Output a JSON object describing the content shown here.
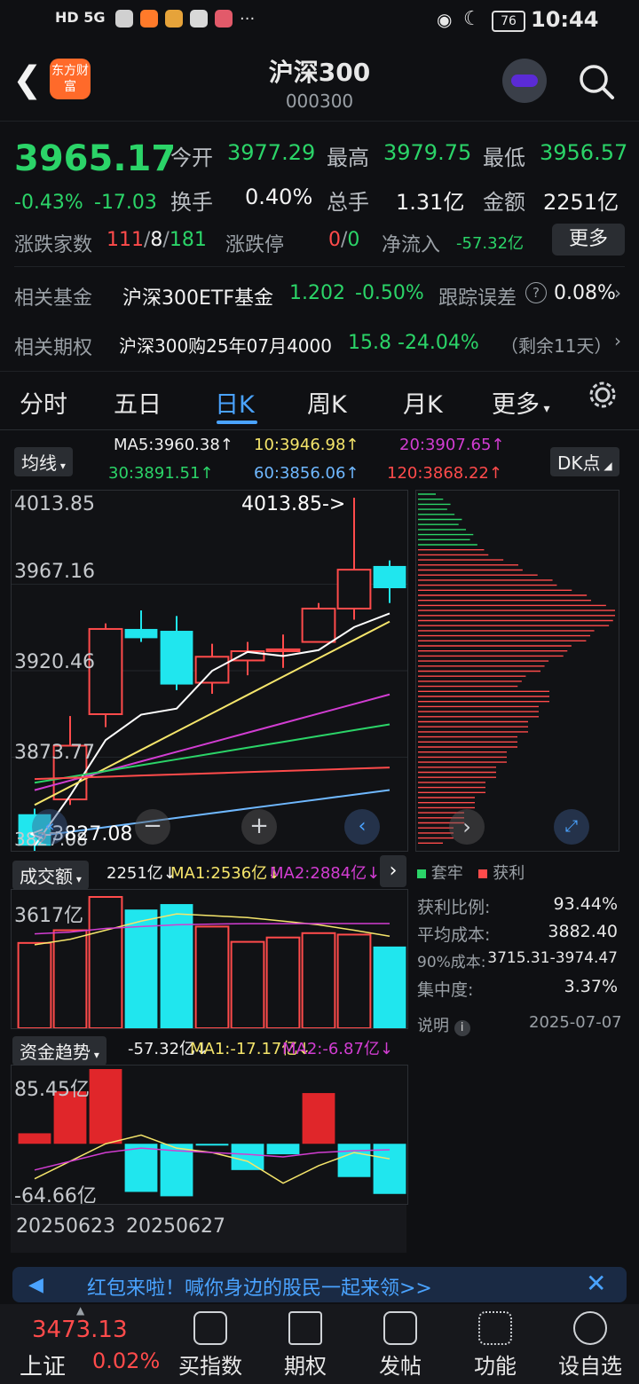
{
  "status_bar": {
    "left_text": "HD 5G",
    "time": "10:44",
    "battery": "76"
  },
  "header": {
    "logo_text": "东方财富",
    "title": "沪深300",
    "code": "000300"
  },
  "quote": {
    "price": "3965.17",
    "change_pct": "-0.43%",
    "change": "-17.03",
    "open_label": "今开",
    "open": "3977.29",
    "high_label": "最高",
    "high": "3979.75",
    "low_label": "最低",
    "low": "3956.57",
    "turnover_label": "换手",
    "turnover": "0.40%",
    "volume_label": "总手",
    "volume": "1.31亿",
    "amount_label": "金额",
    "amount": "2251亿",
    "adv_label": "涨跌家数",
    "adv_up": "111",
    "adv_sep1": "/",
    "adv_flat": "8",
    "adv_sep2": "/",
    "adv_down": "181",
    "limit_label": "涨跌停",
    "limit_up": "0",
    "limit_sep": "/",
    "limit_down": "0",
    "inflow_label": "净流入",
    "inflow": "-57.32亿",
    "more_button": "更多"
  },
  "related": {
    "fund_label": "相关基金",
    "fund_name": "沪深300ETF基金",
    "fund_price": "1.202",
    "fund_chg": "-0.50%",
    "tracking_label": "跟踪误差",
    "tracking_value": "0.08%",
    "option_label": "相关期权",
    "option_name": "沪深300购25年07月4000",
    "option_price": "15.8",
    "option_chg": "-24.04%",
    "option_days": "（剩余11天）"
  },
  "tabs": [
    "分时",
    "五日",
    "日K",
    "周K",
    "月K",
    "更多"
  ],
  "ma_bar": {
    "selector": "均线",
    "ma5": "MA5:3960.38↑",
    "ma10": "10:3946.98↑",
    "ma20": "20:3907.65↑",
    "ma30": "30:3891.51↑",
    "ma60": "60:3856.06↑",
    "ma120": "120:3868.22↑",
    "dk_button": "DK点"
  },
  "kline": {
    "y_labels": [
      "4013.85",
      "3967.16",
      "3920.46",
      "3873.77",
      "3827.08"
    ],
    "high_marker": "4013.85->",
    "low_marker": "<-3827.08"
  },
  "chip_legend": {
    "trapped": "套牢",
    "profit": "获利"
  },
  "chip_stats": [
    {
      "label": "获利比例:",
      "value": "93.44%"
    },
    {
      "label": "平均成本:",
      "value": "3882.40"
    },
    {
      "label": "90%成本:",
      "value": "3715.31-3974.47"
    },
    {
      "label": "集中度:",
      "value": "3.37%"
    }
  ],
  "chip_note": {
    "label": "说明",
    "date": "2025-07-07"
  },
  "volume_bar": {
    "selector": "成交额",
    "value": "2251亿↓",
    "ma1": "MA1:2536亿↓",
    "ma2": "MA2:2884亿↓",
    "y_top": "3617亿"
  },
  "fund_bar": {
    "selector": "资金趋势",
    "value": "-57.32亿↓",
    "ma1": "MA1:-17.17亿↓",
    "ma2": "MA2:-6.87亿↓",
    "y_top": "85.45亿",
    "y_bottom": "-64.66亿"
  },
  "dates": [
    "20250623",
    "20250627"
  ],
  "banner": {
    "text": "红包来啦！喊你身边的股民一起来领>>"
  },
  "bottom_nav": {
    "index_name": "上证",
    "index_value": "3473.13",
    "index_chg": "0.02%",
    "items": [
      "买指数",
      "期权",
      "发帖",
      "功能",
      "设自选"
    ]
  },
  "colors": {
    "up": "#ff4b4b",
    "down": "#2bd468",
    "accent": "#4aa3ff",
    "cyan": "#20e6ee"
  },
  "chart_data": {
    "type": "candlestick",
    "candles": [
      {
        "open": 3843,
        "close": 3826,
        "high": 3846,
        "low": 3820
      },
      {
        "open": 3851,
        "close": 3880,
        "high": 3896,
        "low": 3848
      },
      {
        "open": 3897,
        "close": 3943,
        "high": 3946,
        "low": 3890
      },
      {
        "open": 3943,
        "close": 3938,
        "high": 3953,
        "low": 3936
      },
      {
        "open": 3942,
        "close": 3913,
        "high": 3950,
        "low": 3910
      },
      {
        "open": 3914,
        "close": 3928,
        "high": 3935,
        "low": 3908
      },
      {
        "open": 3926,
        "close": 3931,
        "high": 3936,
        "low": 3918
      },
      {
        "open": 3931,
        "close": 3932,
        "high": 3940,
        "low": 3922
      },
      {
        "open": 3936,
        "close": 3954,
        "high": 3957,
        "low": 3936
      },
      {
        "open": 3954,
        "close": 3975,
        "high": 4013.85,
        "low": 3948
      },
      {
        "open": 3977,
        "close": 3965,
        "high": 3980,
        "low": 3957
      }
    ],
    "ylim": [
      3827.08,
      4013.85
    ],
    "volume": [
      {
        "v": 2350,
        "up": true
      },
      {
        "v": 2700,
        "up": true
      },
      {
        "v": 3617,
        "up": true
      },
      {
        "v": 3270,
        "up": false
      },
      {
        "v": 3420,
        "up": false
      },
      {
        "v": 2800,
        "up": true
      },
      {
        "v": 2380,
        "up": true
      },
      {
        "v": 2500,
        "up": true
      },
      {
        "v": 2620,
        "up": true
      },
      {
        "v": 2580,
        "up": true
      },
      {
        "v": 2251,
        "up": false
      }
    ],
    "fund_flow": [
      12,
      60,
      85.45,
      -55,
      -60,
      -2,
      -30,
      -12,
      58,
      -38,
      -57.32
    ]
  }
}
